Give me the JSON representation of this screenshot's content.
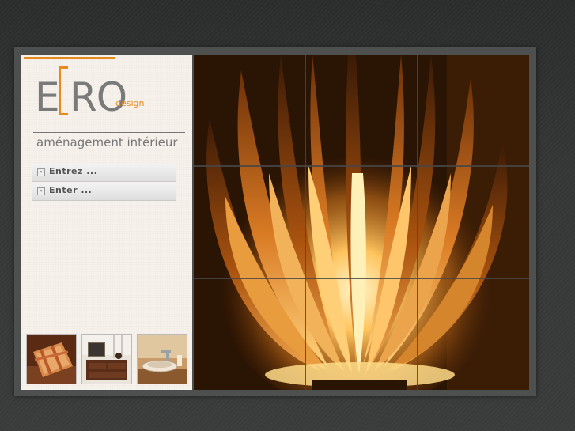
{
  "logo": {
    "letter_e": "E",
    "letters_ro": "RO",
    "design": "design"
  },
  "tagline": "aménagement intérieur",
  "menu": [
    {
      "label": "Entrez ..."
    },
    {
      "label": "Enter ..."
    }
  ],
  "colors": {
    "accent": "#e8891c",
    "logo_gray": "#7a7a7a",
    "sidebar_bg": "#f6f1ea",
    "page_bg": "#333434"
  },
  "thumbnails": [
    {
      "name": "cushion-photo"
    },
    {
      "name": "furniture-photo"
    },
    {
      "name": "bathroom-sink-photo"
    }
  ],
  "main_image": {
    "name": "lamp-photo",
    "grid": "3x3"
  }
}
